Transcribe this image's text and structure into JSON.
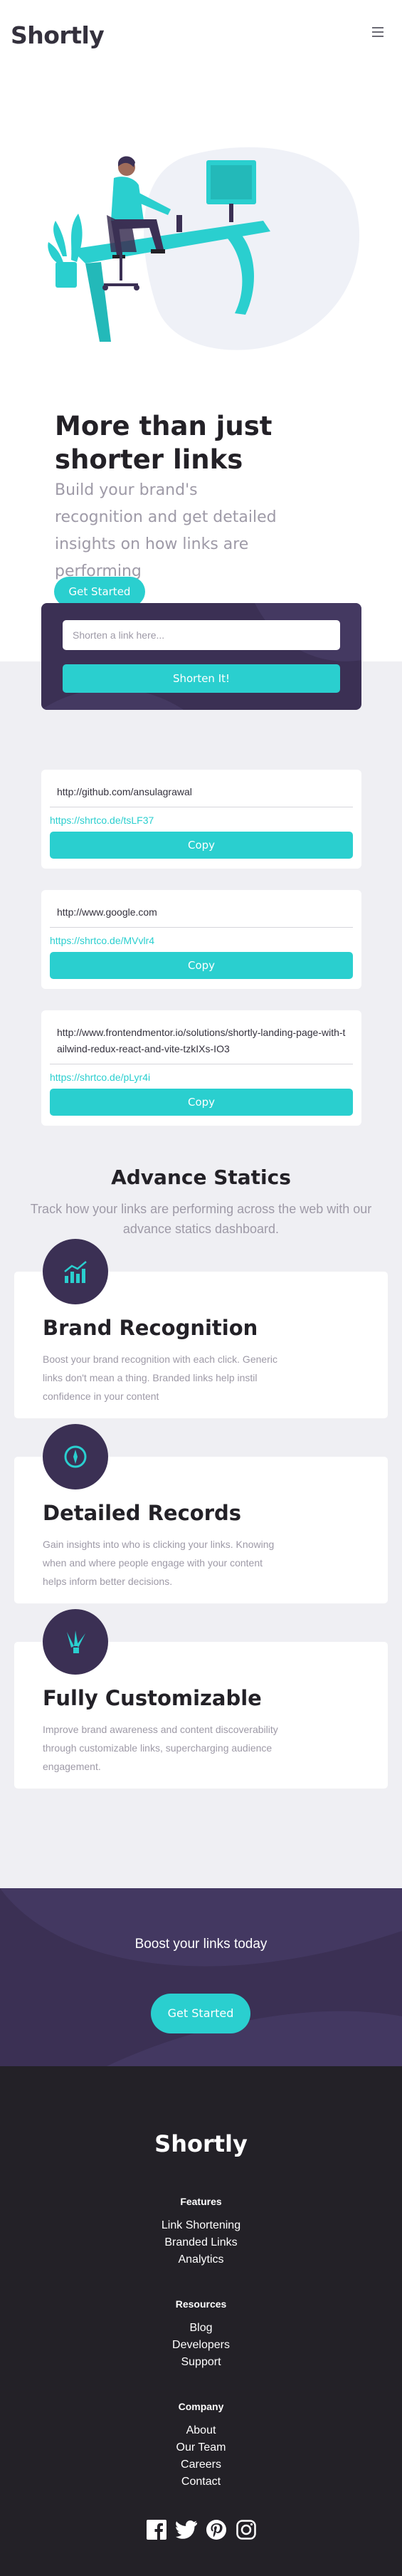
{
  "header": {
    "logo": "Shortly",
    "menu_icon": "hamburger-icon"
  },
  "hero": {
    "title": "More than just shorter links",
    "subtitle": "Build your brand's recognition and get detailed insights on how links are performing",
    "cta_label": "Get Started"
  },
  "shorten": {
    "placeholder": "Shorten a link here...",
    "button_label": "Shorten It!"
  },
  "results": [
    {
      "original": "http://github.com/ansulagrawal",
      "short": "https://shrtco.de/tsLF37",
      "copy_label": "Copy"
    },
    {
      "original": "http://www.google.com",
      "short": "https://shrtco.de/MVvlr4",
      "copy_label": "Copy"
    },
    {
      "original": "http://www.frontendmentor.io/solutions/shortly-landing-page-with-tailwind-redux-react-and-vite-tzkIXs-IO3",
      "short": "https://shrtco.de/pLyr4i",
      "copy_label": "Copy"
    }
  ],
  "stats": {
    "title": "Advance Statics",
    "subtitle": "Track how your links are performing across the web with our advance statics dashboard."
  },
  "features": [
    {
      "icon": "brand-recognition-icon",
      "title": "Brand Recognition",
      "description": "Boost your brand recognition with each click. Generic links don't mean a thing. Branded links help instil confidence in your content"
    },
    {
      "icon": "detailed-records-icon",
      "title": "Detailed Records",
      "description": "Gain insights into who is clicking your links. Knowing when and where people engage with your content helps inform better decisions."
    },
    {
      "icon": "fully-customizable-icon",
      "title": "Fully Customizable",
      "description": "Improve brand awareness and content discoverability through customizable links, supercharging audience engagement."
    }
  ],
  "boost": {
    "title": "Boost your links today",
    "cta_label": "Get Started"
  },
  "footer": {
    "logo": "Shortly",
    "features": {
      "heading": "Features",
      "links": [
        "Link Shortening",
        "Branded Links",
        "Analytics"
      ]
    },
    "resources": {
      "heading": "Resources",
      "links": [
        "Blog",
        "Developers",
        "Support"
      ]
    },
    "company": {
      "heading": "Company",
      "links": [
        "About",
        "Our Team",
        "Careers",
        "Contact"
      ]
    },
    "social_icons": [
      "facebook-icon",
      "twitter-icon",
      "pinterest-icon",
      "instagram-icon"
    ]
  },
  "colors": {
    "primary": "#2acfcf",
    "dark_violet": "#3b3054",
    "very_dark": "#232127",
    "gray_bg": "#efeff3",
    "text_gray": "#9e9aa7"
  }
}
